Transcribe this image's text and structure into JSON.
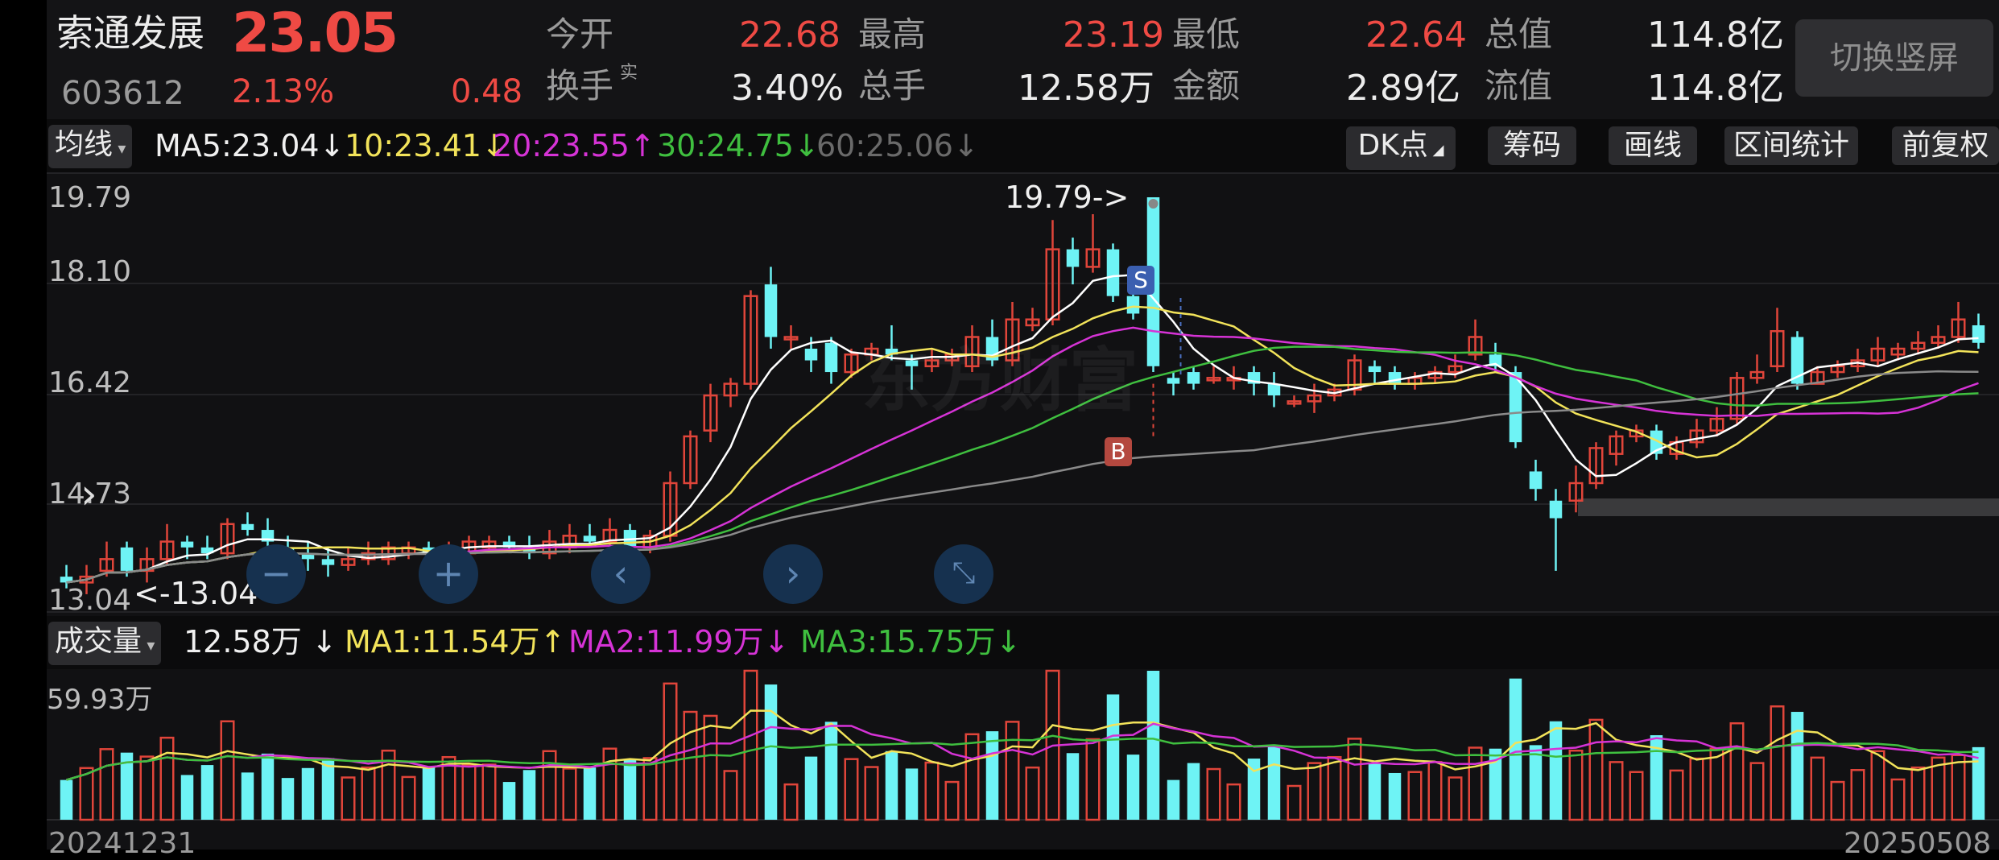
{
  "stock": {
    "name": "索通发展",
    "price": "23.05",
    "code": "603612",
    "change_pct": "2.13%",
    "change": "0.48"
  },
  "quote": {
    "open_label": "今开",
    "open": "22.68",
    "high_label": "最高",
    "high": "23.19",
    "low_label": "最低",
    "low": "22.64",
    "mktcap_label": "总值",
    "mktcap": "114.8亿",
    "turnover_label": "换手",
    "turnover_sup": "实",
    "turnover": "3.40%",
    "volume_label": "总手",
    "volume": "12.58万",
    "amount_label": "金额",
    "amount": "2.89亿",
    "float_label": "流值",
    "float_cap": "114.8亿"
  },
  "switch_button": "切换竖屏",
  "ma_bar": {
    "select": "均线",
    "ma5": "MA5:23.04",
    "ma10": "10:23.41",
    "ma20": "20:23.55",
    "ma30": "30:24.75",
    "ma60": "60:25.06",
    "dk": "DK点",
    "chips": "筹码",
    "draw": "画线",
    "interval": "区间统计",
    "adjust": "前复权"
  },
  "price_axis": {
    "l1": "19.79",
    "l2": "18.10",
    "l3": "16.42",
    "l4": "14.73",
    "l5": "13.04"
  },
  "annotations": {
    "high_mark": "19.79->",
    "low_mark": "<-13.04",
    "sell_badge": "S",
    "buy_badge": "B",
    "watermark": "东方财富"
  },
  "vol_bar": {
    "select": "成交量",
    "vol": "12.58万",
    "ma1": "MA1:11.54万",
    "ma2": "MA2:11.99万",
    "ma3": "MA3:15.75万",
    "axis_max": "59.93万"
  },
  "dates": {
    "start": "20241231",
    "end": "20250508"
  },
  "arrows": {
    "down": "↓",
    "up": "↑"
  },
  "colors": {
    "up": "#e0453a",
    "down": "#6ef3f5",
    "ma5": "#ffffff",
    "ma10": "#f2e35a",
    "ma20": "#d633d6",
    "ma30": "#3fbf3f",
    "ma60": "#8a8a8a"
  },
  "chart_data": {
    "type": "candlestick",
    "ylim": [
      13.04,
      19.79
    ],
    "candles": [
      [
        13.3,
        13.2,
        13.5,
        13.1
      ],
      [
        13.2,
        13.3,
        13.5,
        13.0
      ],
      [
        13.4,
        13.6,
        13.9,
        13.3
      ],
      [
        13.8,
        13.4,
        13.9,
        13.3
      ],
      [
        13.4,
        13.6,
        13.8,
        13.2
      ],
      [
        13.6,
        13.9,
        14.2,
        13.5
      ],
      [
        13.9,
        13.8,
        14.0,
        13.6
      ],
      [
        13.8,
        13.7,
        14.0,
        13.6
      ],
      [
        13.7,
        14.2,
        14.3,
        13.6
      ],
      [
        14.2,
        14.1,
        14.4,
        14.0
      ],
      [
        14.1,
        13.9,
        14.3,
        13.8
      ],
      [
        13.8,
        13.7,
        14.0,
        13.5
      ],
      [
        13.7,
        13.6,
        13.9,
        13.4
      ],
      [
        13.6,
        13.5,
        13.8,
        13.3
      ],
      [
        13.5,
        13.6,
        13.8,
        13.4
      ],
      [
        13.6,
        13.7,
        13.9,
        13.5
      ],
      [
        13.6,
        13.8,
        13.9,
        13.5
      ],
      [
        13.7,
        13.8,
        13.9,
        13.6
      ],
      [
        13.8,
        13.7,
        13.9,
        13.6
      ],
      [
        13.7,
        13.8,
        13.9,
        13.6
      ],
      [
        13.7,
        13.9,
        14.0,
        13.6
      ],
      [
        13.8,
        13.9,
        14.0,
        13.7
      ],
      [
        13.9,
        13.8,
        14.0,
        13.7
      ],
      [
        13.8,
        13.7,
        14.0,
        13.6
      ],
      [
        13.7,
        13.9,
        14.1,
        13.6
      ],
      [
        13.8,
        14.0,
        14.2,
        13.7
      ],
      [
        14.0,
        13.9,
        14.2,
        13.8
      ],
      [
        13.9,
        14.1,
        14.3,
        13.8
      ],
      [
        14.1,
        13.8,
        14.2,
        13.7
      ],
      [
        13.8,
        14.0,
        14.1,
        13.7
      ],
      [
        14.0,
        14.9,
        15.1,
        13.9
      ],
      [
        14.9,
        15.7,
        15.8,
        14.8
      ],
      [
        15.8,
        16.4,
        16.6,
        15.6
      ],
      [
        16.4,
        16.6,
        16.7,
        16.2
      ],
      [
        16.6,
        18.1,
        18.2,
        16.5
      ],
      [
        18.3,
        17.4,
        18.6,
        17.2
      ],
      [
        17.4,
        17.4,
        17.6,
        17.2
      ],
      [
        17.2,
        17.0,
        17.4,
        16.8
      ],
      [
        17.3,
        16.8,
        17.4,
        16.6
      ],
      [
        16.8,
        17.1,
        17.2,
        16.7
      ],
      [
        17.1,
        17.2,
        17.3,
        17.0
      ],
      [
        17.2,
        17.1,
        17.6,
        17.0
      ],
      [
        17.0,
        16.9,
        17.1,
        16.5
      ],
      [
        16.9,
        17.0,
        17.2,
        16.8
      ],
      [
        17.0,
        17.1,
        17.2,
        16.9
      ],
      [
        16.9,
        17.4,
        17.6,
        16.8
      ],
      [
        17.4,
        17.0,
        17.7,
        16.9
      ],
      [
        17.0,
        17.7,
        18.0,
        16.9
      ],
      [
        17.6,
        17.7,
        17.9,
        17.5
      ],
      [
        17.7,
        18.9,
        19.4,
        17.6
      ],
      [
        18.9,
        18.6,
        19.1,
        18.3
      ],
      [
        18.6,
        18.9,
        19.5,
        18.5
      ],
      [
        18.9,
        18.1,
        19.0,
        18.0
      ],
      [
        18.1,
        17.8,
        18.3,
        17.7
      ],
      [
        19.79,
        16.9,
        19.79,
        16.8
      ],
      [
        16.7,
        16.6,
        16.8,
        16.4
      ],
      [
        16.8,
        16.6,
        16.9,
        16.5
      ],
      [
        16.7,
        16.7,
        16.9,
        16.6
      ],
      [
        16.7,
        16.7,
        16.9,
        16.5
      ],
      [
        16.8,
        16.6,
        16.9,
        16.4
      ],
      [
        16.6,
        16.4,
        16.8,
        16.2
      ],
      [
        16.3,
        16.3,
        16.4,
        16.2
      ],
      [
        16.3,
        16.4,
        16.6,
        16.1
      ],
      [
        16.4,
        16.5,
        16.6,
        16.3
      ],
      [
        16.5,
        17.0,
        17.1,
        16.4
      ],
      [
        16.9,
        16.8,
        17.0,
        16.6
      ],
      [
        16.8,
        16.6,
        16.9,
        16.5
      ],
      [
        16.6,
        16.7,
        16.8,
        16.5
      ],
      [
        16.7,
        16.8,
        16.9,
        16.6
      ],
      [
        16.8,
        16.9,
        17.1,
        16.7
      ],
      [
        17.1,
        17.4,
        17.7,
        17.0
      ],
      [
        17.1,
        16.9,
        17.3,
        16.8
      ],
      [
        16.8,
        15.6,
        16.9,
        15.5
      ],
      [
        15.1,
        14.8,
        15.3,
        14.6
      ],
      [
        14.6,
        14.3,
        14.8,
        13.4
      ],
      [
        14.6,
        14.9,
        15.2,
        14.4
      ],
      [
        14.9,
        15.5,
        15.6,
        14.8
      ],
      [
        15.4,
        15.7,
        15.8,
        15.2
      ],
      [
        15.7,
        15.8,
        15.9,
        15.6
      ],
      [
        15.8,
        15.4,
        15.9,
        15.3
      ],
      [
        15.4,
        15.6,
        15.7,
        15.3
      ],
      [
        15.6,
        15.8,
        16.0,
        15.5
      ],
      [
        15.8,
        16.0,
        16.2,
        15.7
      ],
      [
        16.0,
        16.7,
        16.8,
        15.9
      ],
      [
        16.7,
        16.8,
        17.1,
        16.6
      ],
      [
        16.9,
        17.5,
        17.9,
        16.8
      ],
      [
        17.4,
        16.6,
        17.5,
        16.5
      ],
      [
        16.6,
        16.8,
        16.9,
        16.6
      ],
      [
        16.8,
        16.9,
        17.0,
        16.7
      ],
      [
        16.9,
        17.0,
        17.2,
        16.8
      ],
      [
        17.0,
        17.2,
        17.4,
        16.9
      ],
      [
        17.1,
        17.2,
        17.3,
        17.0
      ],
      [
        17.2,
        17.3,
        17.5,
        17.1
      ],
      [
        17.3,
        17.4,
        17.6,
        17.2
      ],
      [
        17.4,
        17.7,
        18.0,
        17.3
      ],
      [
        17.6,
        17.3,
        17.8,
        17.2
      ]
    ],
    "volume_max": 59.93
  }
}
